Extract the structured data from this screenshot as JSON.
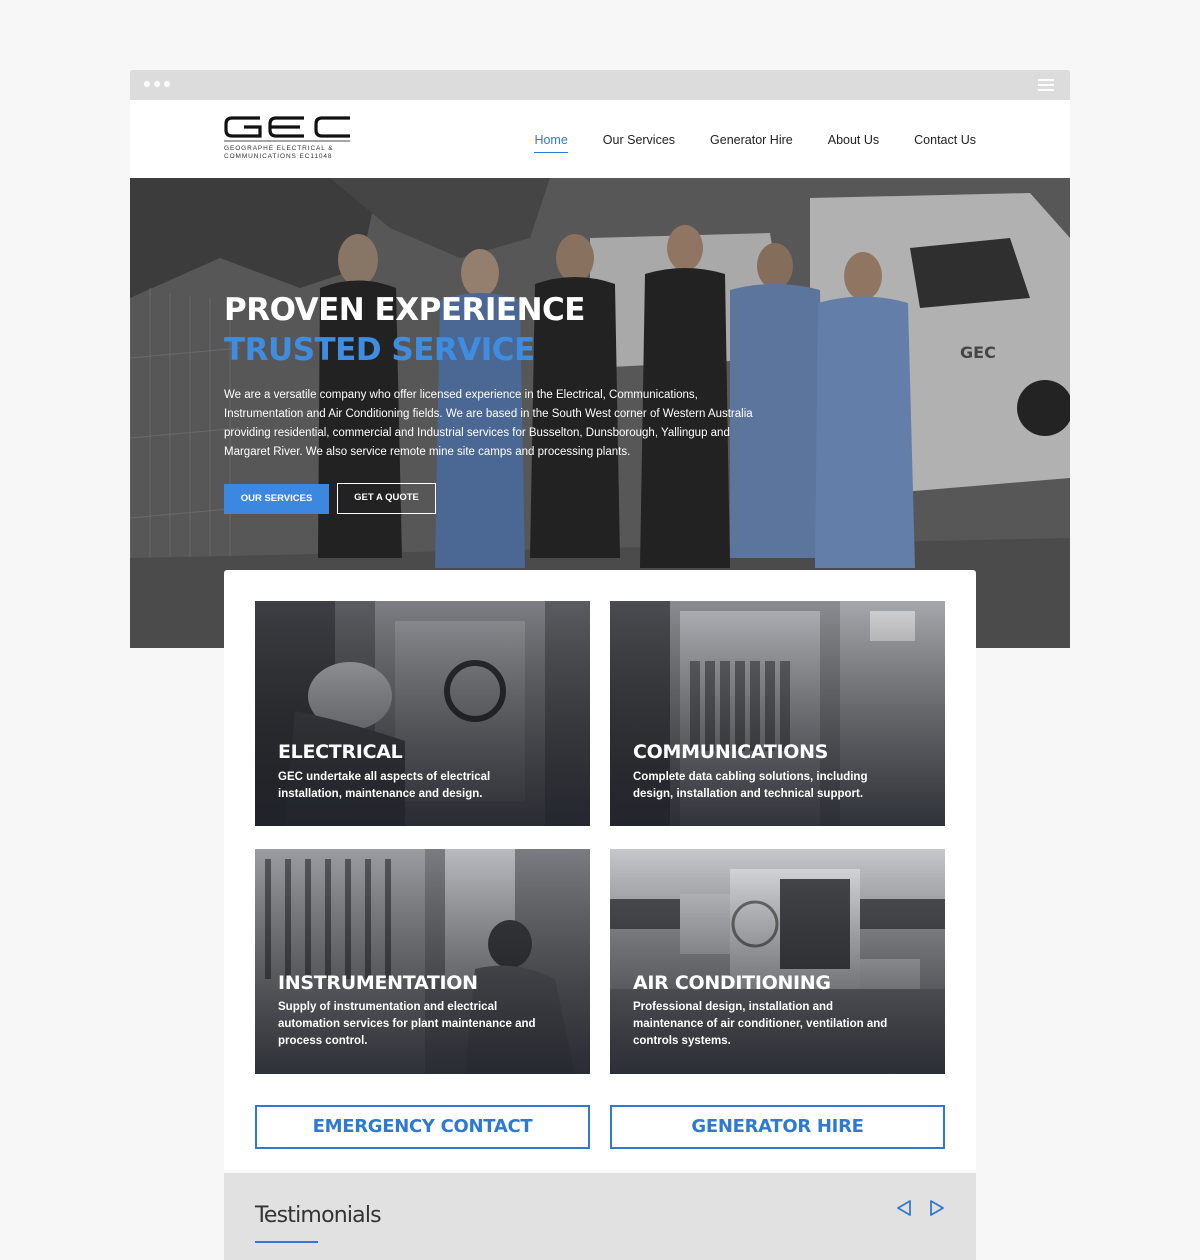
{
  "browser": {
    "dots_icon": "window-dots-icon",
    "menu_icon": "hamburger-menu-icon"
  },
  "logo": {
    "letters": "GEC",
    "subtitle_line1": "GEOGRAPHE ELECTRICAL &",
    "subtitle_line2": "COMMUNICATIONS EC11048"
  },
  "nav": {
    "home": "Home",
    "services": "Our Services",
    "generator": "Generator Hire",
    "about": "About Us",
    "contact": "Contact Us"
  },
  "hero": {
    "title_line1": "PROVEN EXPERIENCE",
    "title_line2": "TRUSTED SERVICE",
    "text": "We are a versatile company who offer licensed experience in the Electrical, Communications, Instrumentation and Air Conditioning fields. We are based in the South West corner of Western Australia providing residential, commercial and Industrial services for Busselton, Dunsborough, Yallingup and Margaret River. We also service remote mine site camps and processing plants.",
    "primary_button": "OUR SERVICES",
    "secondary_button": "GET A QUOTE"
  },
  "services": [
    {
      "title": "ELECTRICAL",
      "description": "GEC undertake all aspects of electrical installation, maintenance and design."
    },
    {
      "title": "COMMUNICATIONS",
      "description": "Complete data cabling solutions, including design, installation and technical support."
    },
    {
      "title": "INSTRUMENTATION",
      "description": "Supply of instrumentation and electrical automation services for plant maintenance and process control."
    },
    {
      "title": "AIR CONDITIONING",
      "description": "Professional design, installation and maintenance of air conditioner, ventilation and controls systems."
    }
  ],
  "cta": {
    "emergency": "EMERGENCY CONTACT",
    "generator": "GENERATOR HIRE"
  },
  "testimonials": {
    "title": "Testimonials",
    "prev_icon": "arrow-left-icon",
    "next_icon": "arrow-right-icon"
  },
  "colors": {
    "accent": "#2f7ad1",
    "button": "#3c88e0",
    "panel_grey": "#e1e1e1"
  }
}
